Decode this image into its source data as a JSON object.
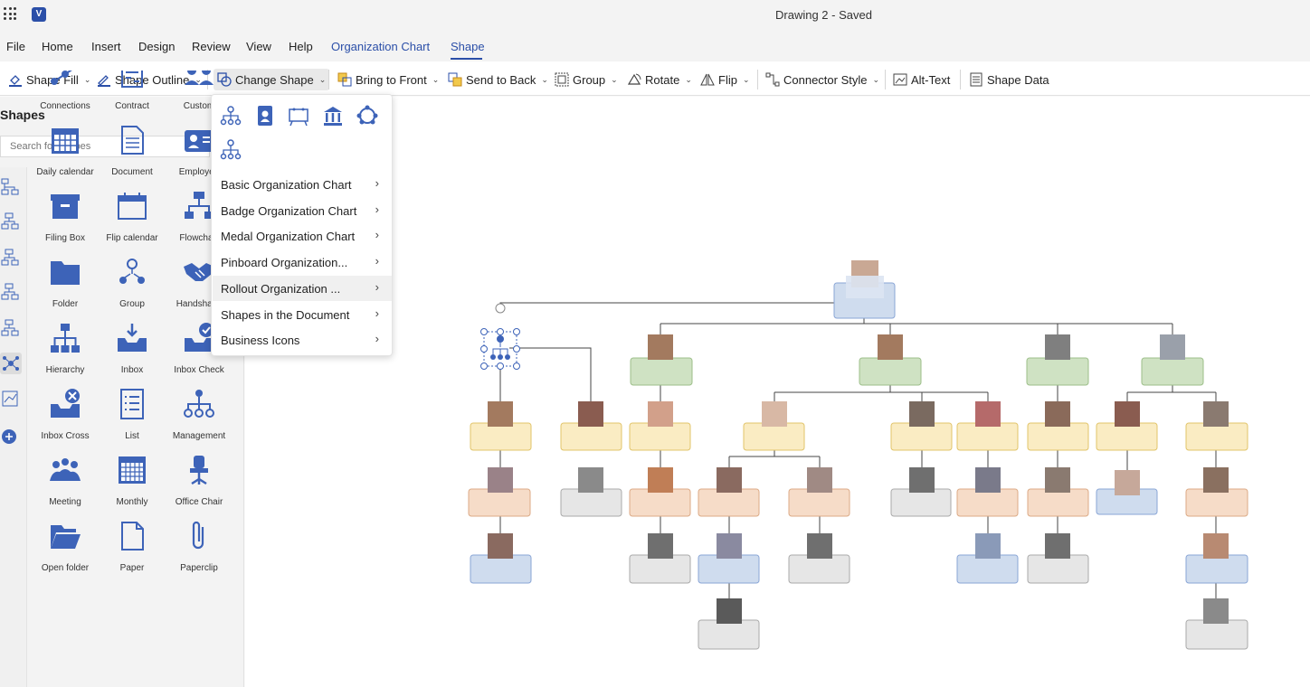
{
  "window": {
    "title": "Drawing 2 - Saved",
    "app_icon": "V"
  },
  "menu": {
    "items": [
      "File",
      "Home",
      "Insert",
      "Design",
      "Review",
      "View",
      "Help",
      "Organization Chart",
      "Shape"
    ],
    "active_contextual": "Organization Chart",
    "active_tab": "Shape"
  },
  "ribbon": {
    "shape_fill": "Shape Fill",
    "shape_outline": "Shape Outline",
    "change_shape": "Change Shape",
    "bring_to_front": "Bring to Front",
    "send_to_back": "Send to Back",
    "group": "Group",
    "rotate": "Rotate",
    "flip": "Flip",
    "connector_style": "Connector Style",
    "alt_text": "Alt-Text",
    "shape_data": "Shape Data"
  },
  "shapes_panel": {
    "title": "Shapes",
    "search_placeholder": "Search for shapes",
    "tiles": [
      "Connections",
      "Contract",
      "Custom",
      "Daily calendar",
      "Document",
      "Employee",
      "Filing Box",
      "Flip calendar",
      "Flowchart",
      "Folder",
      "Group",
      "Handshake",
      "Hierarchy",
      "Inbox",
      "Inbox Check",
      "Inbox Cross",
      "List",
      "Management",
      "Meeting",
      "Monthly",
      "Office Chair",
      "Open folder",
      "Paper",
      "Paperclip"
    ]
  },
  "change_shape_menu": {
    "icons": [
      "hierarchy-icon",
      "badge-icon",
      "pinboard-icon",
      "medal-icon",
      "rollout-icon",
      "business-hierarchy-icon"
    ],
    "items": [
      "Basic Organization Chart",
      "Badge Organization Chart",
      "Medal Organization Chart",
      "Pinboard Organization...",
      "Rollout Organization ...",
      "Shapes in the Document",
      "Business Icons"
    ],
    "hovered_index": 4
  },
  "colors": {
    "accent": "#2b4fa8",
    "node_green": "#cfe2c3",
    "node_yellow": "#faecc3",
    "node_orange": "#f6dcc8",
    "node_blue": "#cfdcee",
    "node_gray": "#e6e6e6"
  }
}
